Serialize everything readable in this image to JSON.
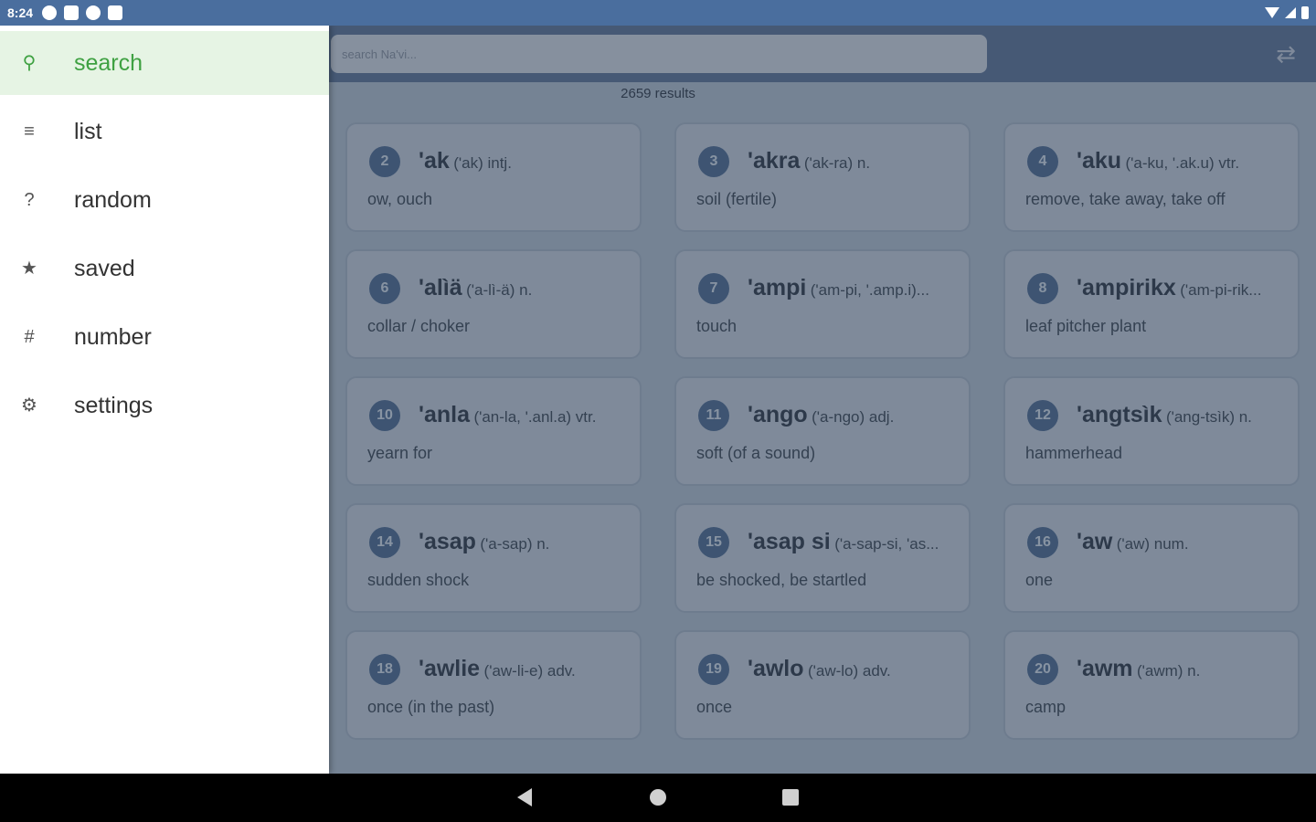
{
  "status_bar": {
    "time": "8:24",
    "icons": [
      "notification-a-icon",
      "notification-square-icon",
      "notification-p-icon",
      "notification-clipboard-icon"
    ],
    "right_icons": [
      "wifi-icon",
      "signal-icon",
      "battery-icon"
    ]
  },
  "search": {
    "placeholder": "search Na'vi..."
  },
  "results_count": "2659 results",
  "drawer": {
    "items": [
      {
        "icon": "search-icon",
        "glyph": "⚲",
        "label": "search",
        "active": true
      },
      {
        "icon": "list-icon",
        "glyph": "≡",
        "label": "list",
        "active": false
      },
      {
        "icon": "random-icon",
        "glyph": "?",
        "label": "random",
        "active": false
      },
      {
        "icon": "star-icon",
        "glyph": "★",
        "label": "saved",
        "active": false
      },
      {
        "icon": "hash-icon",
        "glyph": "#",
        "label": "number",
        "active": false
      },
      {
        "icon": "gear-icon",
        "glyph": "⚙",
        "label": "settings",
        "active": false
      }
    ]
  },
  "cards": [
    {
      "num": "2",
      "word": "'ak",
      "pron": "('ak) intj.",
      "def": "ow, ouch"
    },
    {
      "num": "3",
      "word": "'akra",
      "pron": "('ak-ra) n.",
      "def": "soil (fertile)"
    },
    {
      "num": "4",
      "word": "'aku",
      "pron": "('a-ku, '.ak.u) vtr.",
      "def": "remove, take away, take off"
    },
    {
      "num": "6",
      "word": "'alìä",
      "pron": "('a-lì-ä) n.",
      "def": "collar / choker"
    },
    {
      "num": "7",
      "word": "'ampi",
      "pron": "('am-pi, '.amp.i)...",
      "def": "touch"
    },
    {
      "num": "8",
      "word": "'ampirikx",
      "pron": "('am-pi-rik...",
      "def": "leaf pitcher plant"
    },
    {
      "num": "10",
      "word": "'anla",
      "pron": "('an-la, '.anl.a) vtr.",
      "def": "yearn for"
    },
    {
      "num": "11",
      "word": "'ango",
      "pron": "('a-ngo) adj.",
      "def": "soft (of a sound)"
    },
    {
      "num": "12",
      "word": "'angtsìk",
      "pron": "('ang-tsìk) n.",
      "def": "hammerhead"
    },
    {
      "num": "14",
      "word": "'asap",
      "pron": "('a-sap) n.",
      "def": "sudden shock"
    },
    {
      "num": "15",
      "word": "'asap si",
      "pron": "('a-sap-si, 'as...",
      "def": "be shocked, be startled"
    },
    {
      "num": "16",
      "word": "'aw",
      "pron": "('aw) num.",
      "def": "one"
    },
    {
      "num": "18",
      "word": "'awlie",
      "pron": "('aw-li-e) adv.",
      "def": "once (in the past)"
    },
    {
      "num": "19",
      "word": "'awlo",
      "pron": "('aw-lo) adv.",
      "def": "once"
    },
    {
      "num": "20",
      "word": "'awm",
      "pron": "('awm) n.",
      "def": "camp"
    }
  ]
}
